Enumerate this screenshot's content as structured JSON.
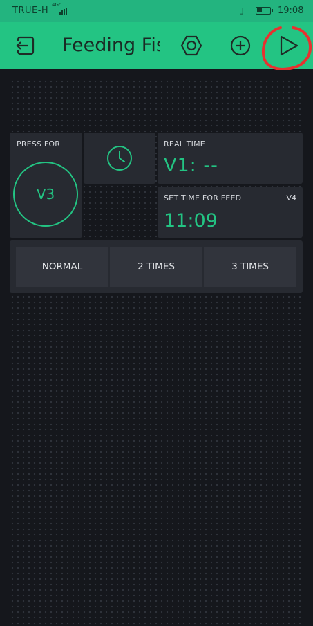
{
  "status_bar": {
    "carrier": "TRUE-H",
    "network": "4G⁺",
    "time": "19:08",
    "icons": [
      "signal-icon",
      "vibrate-icon",
      "battery-icon"
    ]
  },
  "app_bar": {
    "title": "Feeding Fish",
    "color": "#23c483",
    "icons": [
      "back-icon",
      "settings-icon",
      "add-icon",
      "play-icon"
    ]
  },
  "widgets": {
    "button": {
      "label": "PRESS FOR",
      "pin": "V3"
    },
    "clock": {
      "icon": "clock-icon"
    },
    "real_time": {
      "label": "REAL TIME",
      "value": "V1: --"
    },
    "feed_time": {
      "label": "SET TIME FOR FEED",
      "pin": "V4",
      "value": "11:09"
    },
    "segments": {
      "options": [
        "NORMAL",
        "2 TIMES",
        "3 TIMES"
      ]
    }
  },
  "accent_color": "#23c483",
  "annotation_color": "#e8312f"
}
